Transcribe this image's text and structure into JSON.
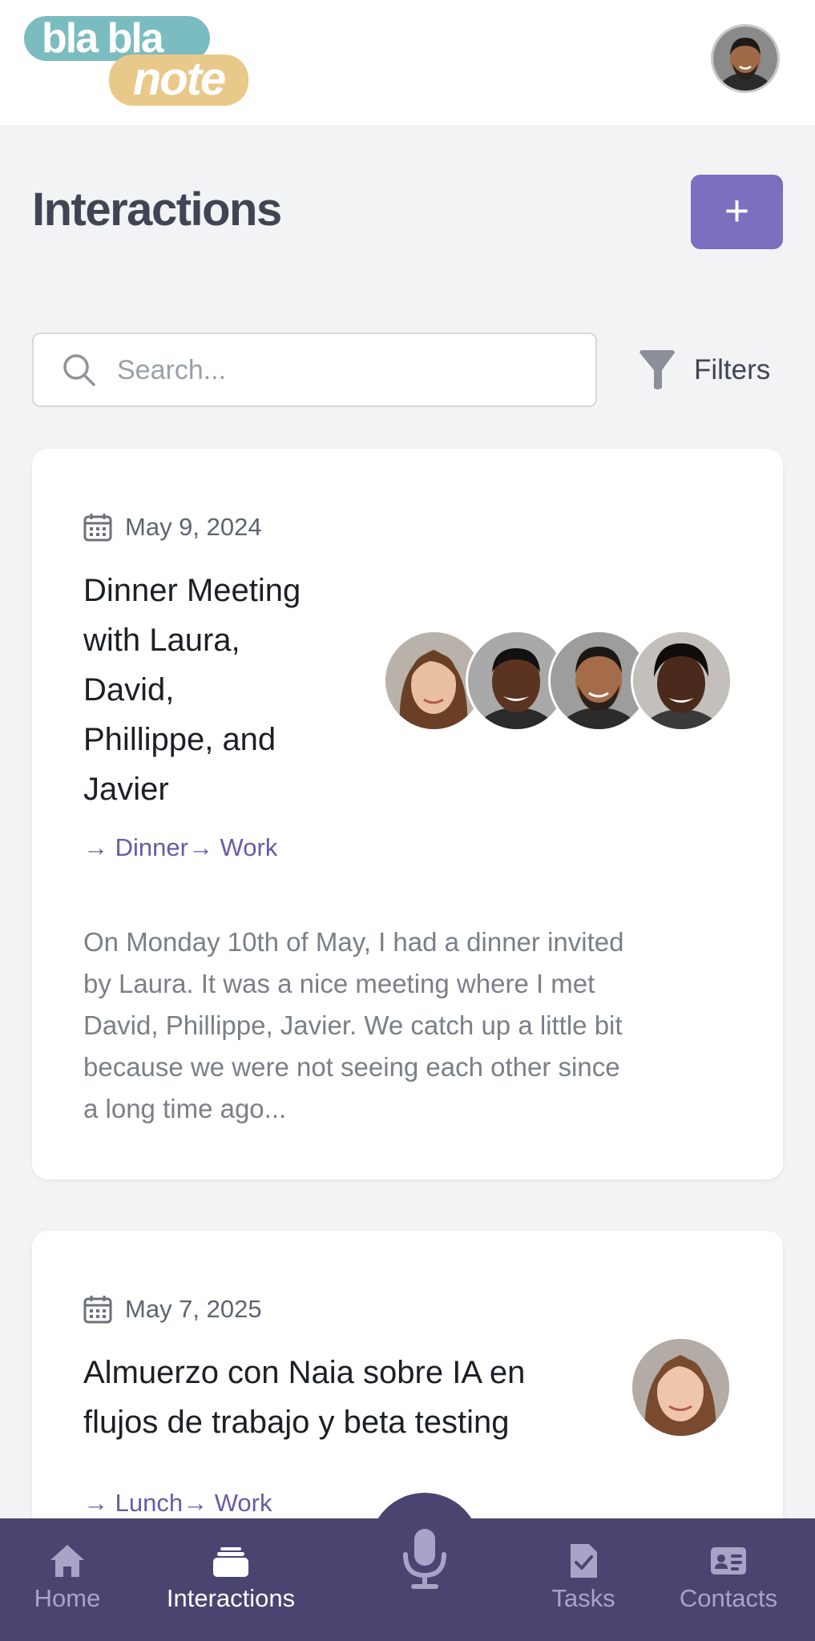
{
  "app": {
    "logo_top": "bla bla",
    "logo_bottom": "note"
  },
  "header": {
    "title": "Interactions",
    "add_button_label": "+"
  },
  "search": {
    "placeholder": "Search...",
    "value": "",
    "filters_label": "Filters"
  },
  "interactions": [
    {
      "date": "May 9, 2024",
      "title_lines": [
        "Dinner Meeting",
        "with Laura,",
        "David,",
        "Phillippe, and",
        "Javier"
      ],
      "tags": [
        "→ Dinner",
        "→ Work"
      ],
      "summary_lines": [
        "On Monday 10th of May, I had a dinner invited",
        "by Laura. It was a nice meeting where I met",
        "David, Phillippe, Javier. We catch up a little bit",
        "because we were not seeing each other since",
        "a long time ago..."
      ]
    },
    {
      "date": "May 7, 2025",
      "title_lines": [
        "Almuerzo con Naia sobre IA en",
        "flujos de trabajo y beta testing"
      ],
      "tags": [
        "→ Lunch",
        "→ Work"
      ]
    }
  ],
  "nav": {
    "items": [
      {
        "label": "Home",
        "icon": "home-icon"
      },
      {
        "label": "Interactions",
        "icon": "interactions-icon"
      },
      {
        "label": "",
        "icon": "microphone-icon"
      },
      {
        "label": "Tasks",
        "icon": "tasks-icon"
      },
      {
        "label": "Contacts",
        "icon": "contacts-icon"
      }
    ],
    "active": "Interactions"
  },
  "colors": {
    "accent": "#7b6fbf",
    "nav_background": "#4a4470",
    "page_background": "#f2f3f5",
    "tag_color": "#6a5aa6"
  }
}
